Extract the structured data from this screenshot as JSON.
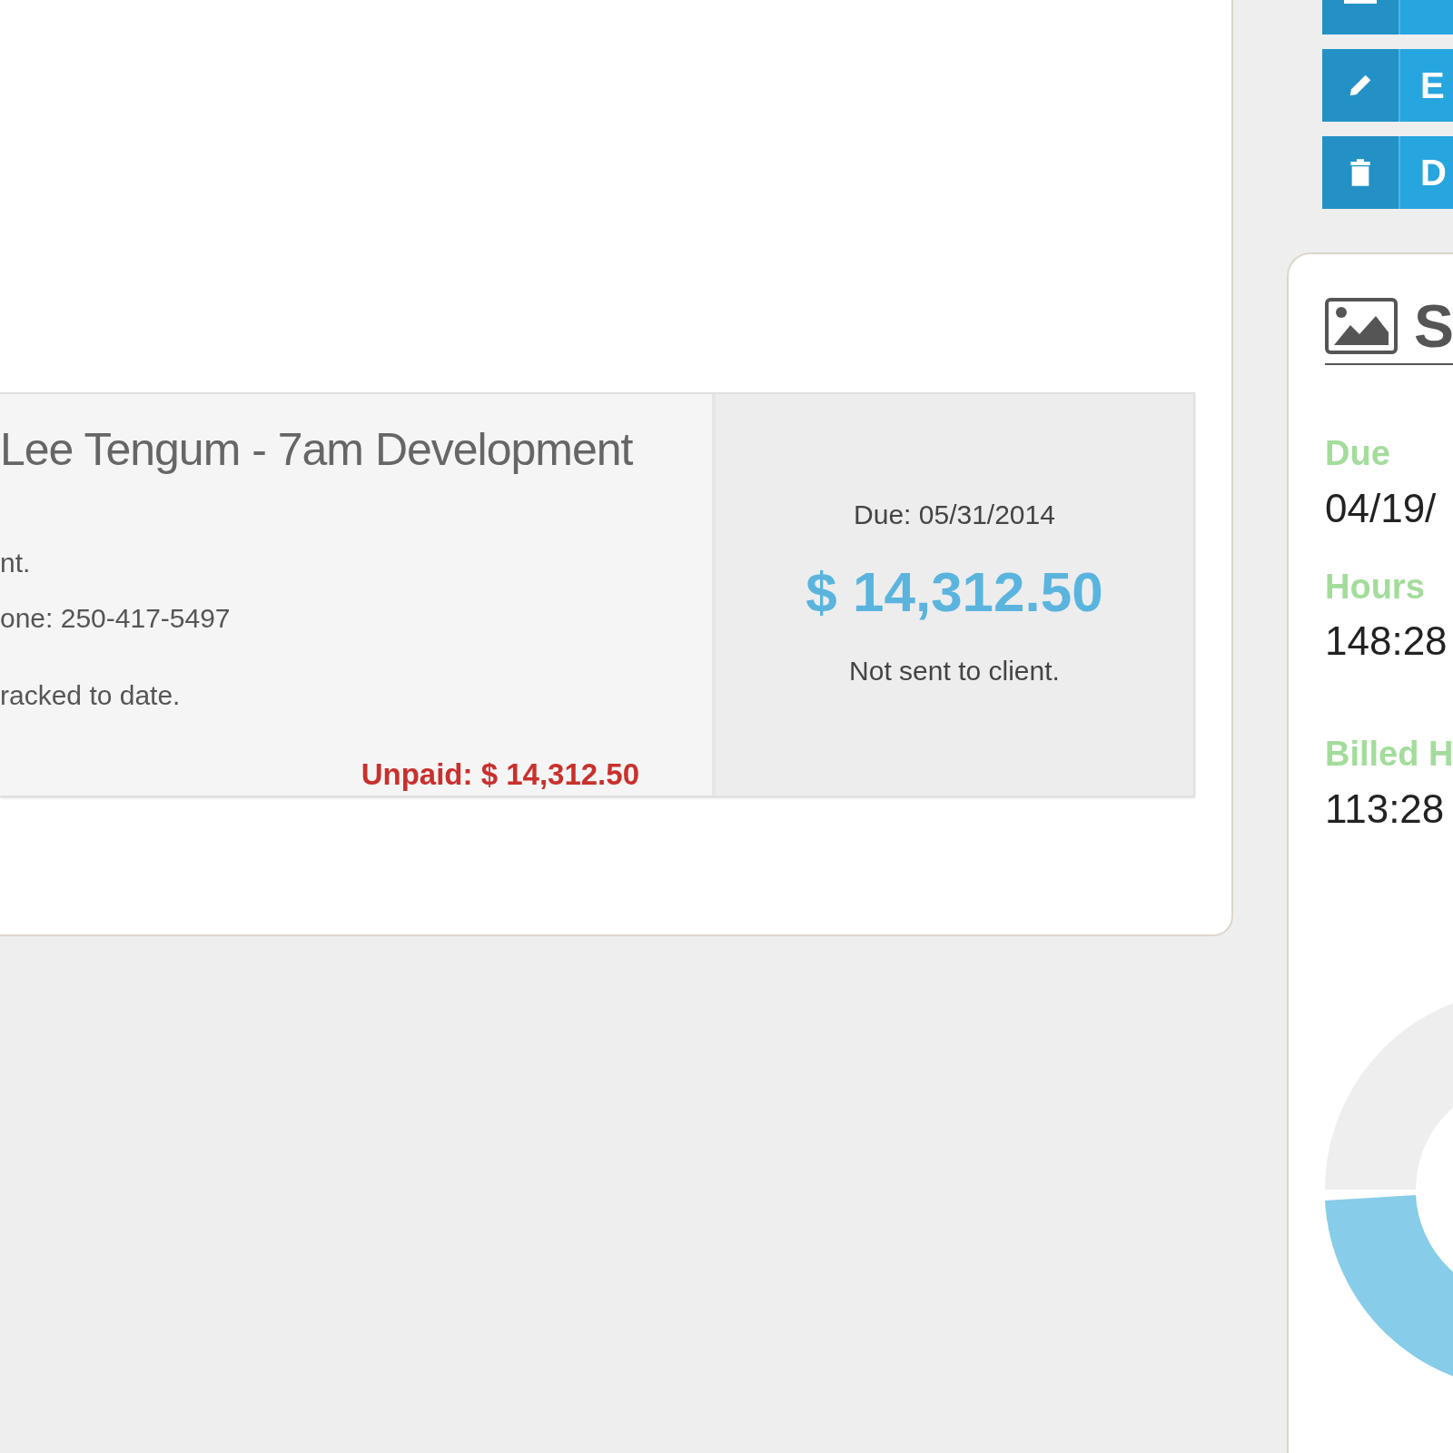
{
  "invoice_card": {
    "title": "Lee Tengum - 7am Development",
    "lines": [
      "nt.",
      "one: 250-417-5497",
      "racked to date."
    ],
    "unpaid": "Unpaid: $ 14,312.50",
    "due": "Due: 05/31/2014",
    "amount": "$ 14,312.50",
    "status": "Not sent to client."
  },
  "actions": [
    {
      "kind": "box"
    },
    {
      "kind": "edit",
      "label": "E"
    },
    {
      "kind": "delete",
      "label": "D"
    }
  ],
  "summary": {
    "title": "S",
    "stats": [
      {
        "label": "Due",
        "value": "04/19/"
      },
      {
        "label": "Hours",
        "value": "148:28"
      },
      {
        "label": "Billed H",
        "value": "113:28"
      }
    ]
  }
}
